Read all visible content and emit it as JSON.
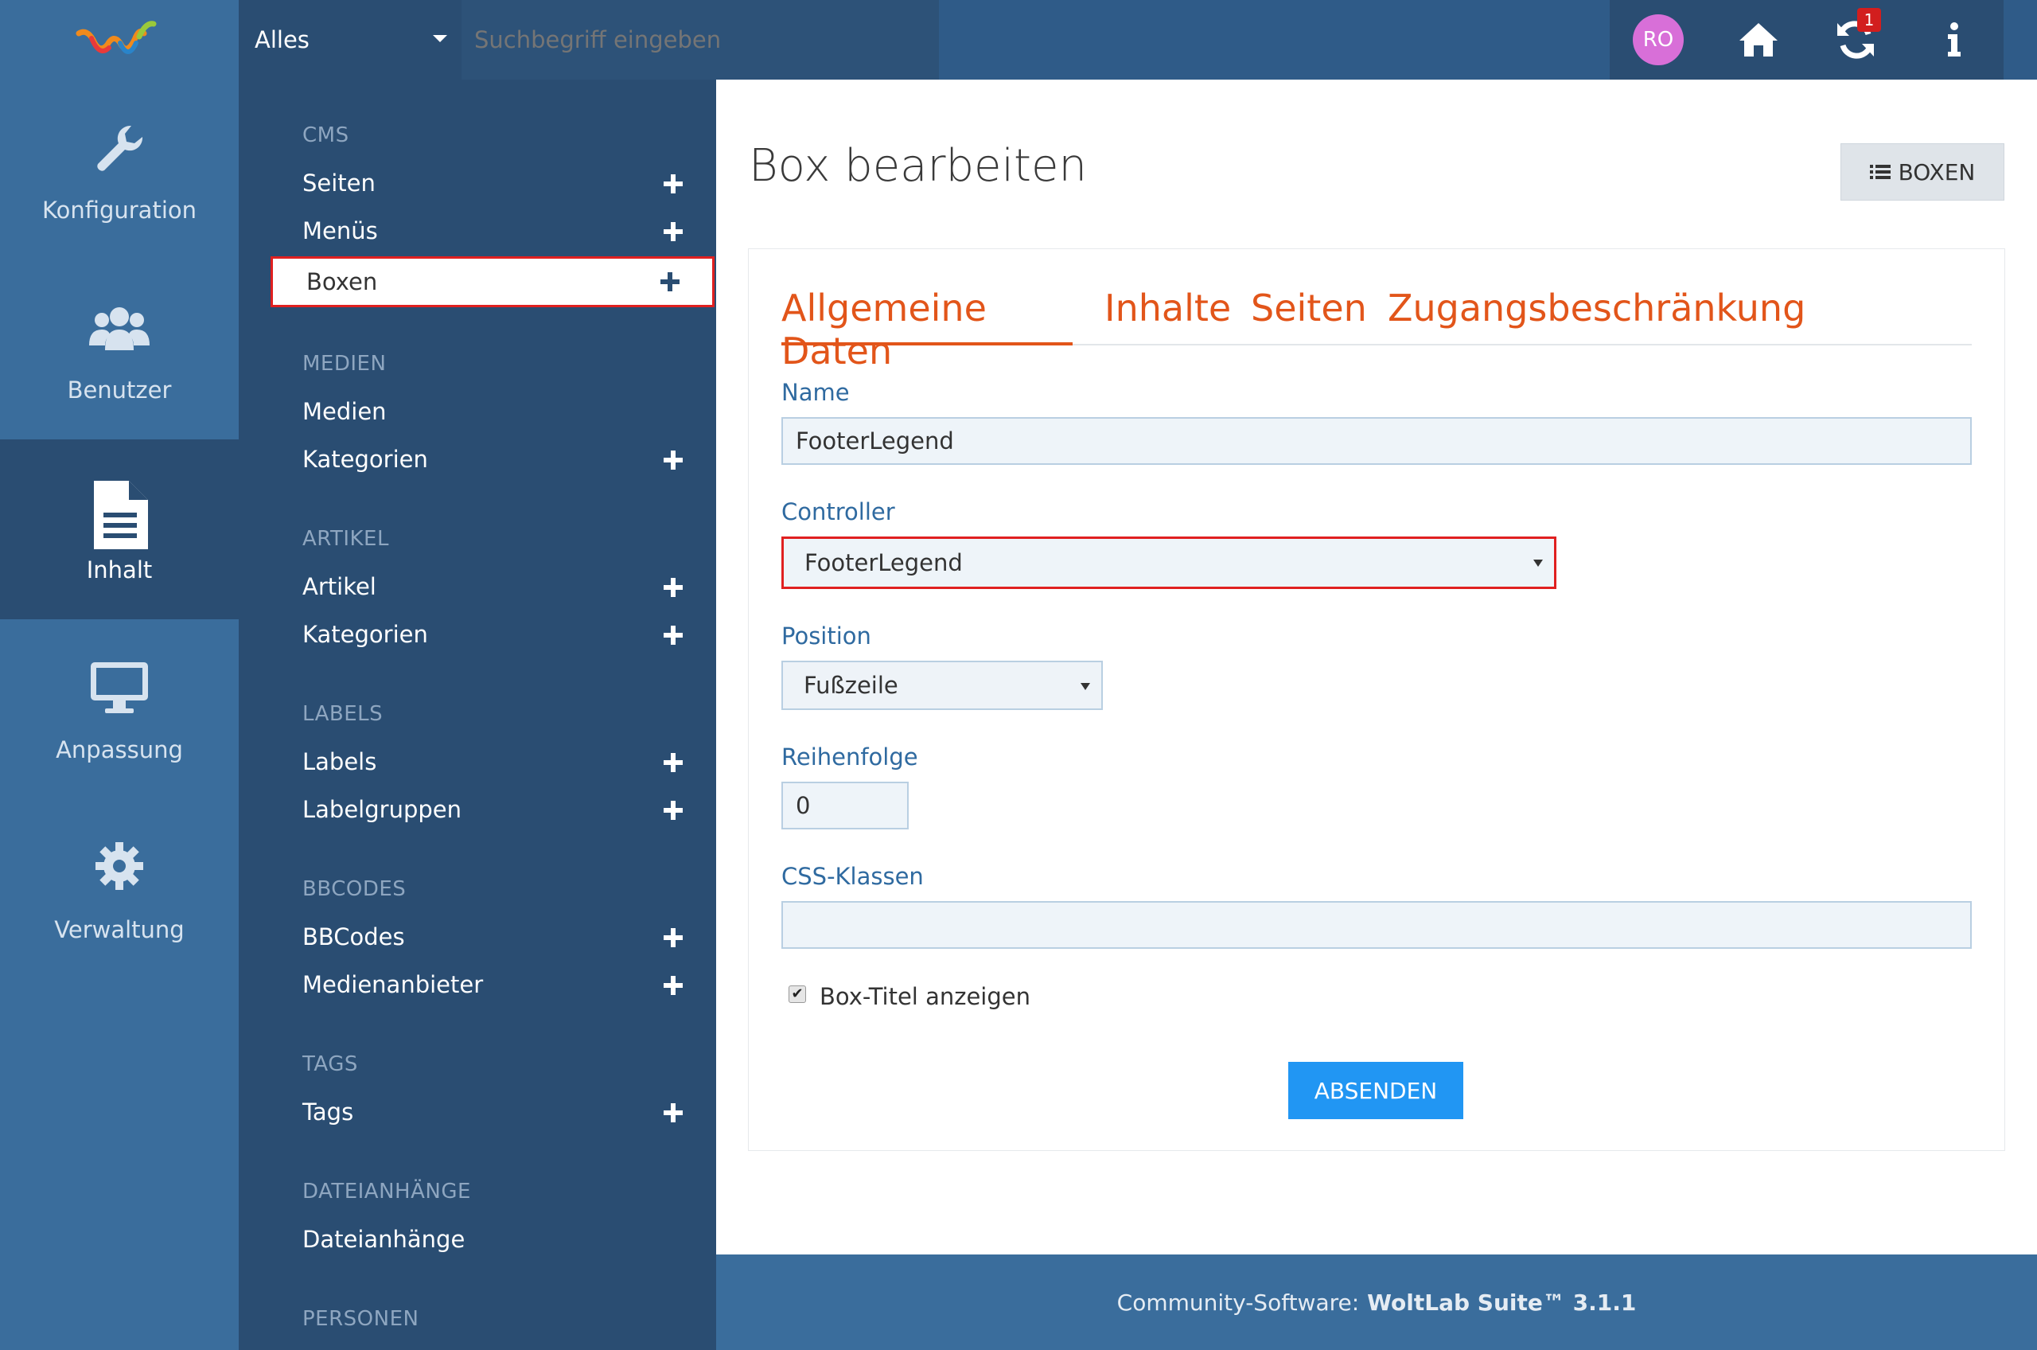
{
  "header": {
    "search_type": "Alles",
    "search_placeholder": "Suchbegriff eingeben",
    "avatar_initials": "RO",
    "notification_count": "1"
  },
  "main_menu": [
    {
      "label": "Konfiguration",
      "icon": "wrench-icon"
    },
    {
      "label": "Benutzer",
      "icon": "users-icon"
    },
    {
      "label": "Inhalt",
      "icon": "file-text-icon",
      "active": true
    },
    {
      "label": "Anpassung",
      "icon": "desktop-icon"
    },
    {
      "label": "Verwaltung",
      "icon": "gear-icon"
    }
  ],
  "sub_menu": {
    "cms": {
      "heading": "CMS",
      "seiten": "Seiten",
      "menues": "Menüs",
      "boxen": "Boxen"
    },
    "medien": {
      "heading": "MEDIEN",
      "medien": "Medien",
      "kategorien": "Kategorien"
    },
    "artikel": {
      "heading": "ARTIKEL",
      "artikel": "Artikel",
      "kategorien": "Kategorien"
    },
    "labels": {
      "heading": "LABELS",
      "labels": "Labels",
      "labelgruppen": "Labelgruppen"
    },
    "bbcodes": {
      "heading": "BBCODES",
      "bbcodes": "BBCodes",
      "medienanbieter": "Medienanbieter"
    },
    "tags": {
      "heading": "TAGS",
      "tags": "Tags"
    },
    "dateianhaenge": {
      "heading": "DATEIANHÄNGE",
      "dateianhaenge": "Dateianhänge"
    },
    "personen": {
      "heading": "PERSONEN"
    }
  },
  "content": {
    "title": "Box bearbeiten",
    "boxes_button": "BOXEN",
    "tabs": [
      "Allgemeine Daten",
      "Inhalte",
      "Seiten",
      "Zugangsbeschränkung"
    ],
    "name_label": "Name",
    "name_value": "FooterLegend",
    "controller_label": "Controller",
    "controller_value": "FooterLegend",
    "position_label": "Position",
    "position_value": "Fußzeile",
    "order_label": "Reihenfolge",
    "order_value": "0",
    "css_label": "CSS-Klassen",
    "css_value": "",
    "show_title_label": "Box-Titel anzeigen",
    "show_title_checked": true,
    "submit_label": "ABSENDEN"
  },
  "footer": {
    "prefix": "Community-Software:",
    "product": "WoltLab Suite™ 3.1.1"
  },
  "colors": {
    "accent": "#e2551a",
    "primary": "#2196f3",
    "sidebar": "#3a6d9c",
    "submenu": "#2a4d72"
  }
}
